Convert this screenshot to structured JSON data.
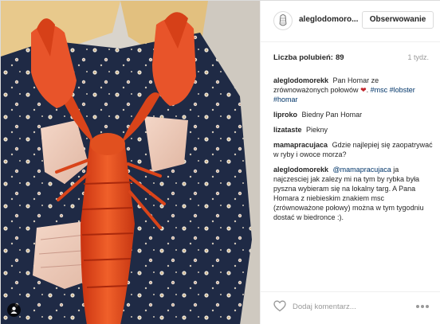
{
  "post": {
    "username": "aleglodomoro...",
    "follow_label": "Obserwowanie",
    "likes_label": "Liczba polubień:",
    "likes_count": "89",
    "timestamp": "1 tydz.",
    "caption": {
      "username": "aleglodomorekk",
      "text": "Pan Homar ze zrównoważonych połowów",
      "emoji": "❤",
      "tags": [
        "#msc",
        "#lobster",
        "#homar"
      ]
    },
    "comments": [
      {
        "username": "liproko",
        "text": "Biedny Pan Homar"
      },
      {
        "username": "lizataste",
        "text": "Piekny"
      },
      {
        "username": "mamapracujaca",
        "text": "Gdzie najlepiej się zaopatrywać w ryby i owoce morza?"
      },
      {
        "username": "aleglodomorekk",
        "mention": "@mamapracujaca",
        "text": "ja najczesciej jak zalezy mi na tym by rybka była pyszna wybieram się na lokalny targ. A Pana Homara z niebieskim znakiem msc (zrównoważone połowy) można w tym tygodniu dostać w biedronce :)."
      }
    ],
    "add_comment_placeholder": "Dodaj komentarz..."
  },
  "icons": {
    "like": "heart-outline-icon",
    "more": "ellipsis-icon",
    "user_tag": "person-icon",
    "avatar": "fish-logo"
  },
  "colors": {
    "link": "#003569",
    "lobster": "#e2481e",
    "heart": "#c1262d"
  }
}
